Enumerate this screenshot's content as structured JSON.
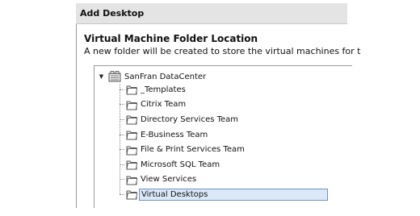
{
  "dialog": {
    "title": "Add Desktop"
  },
  "section": {
    "heading": "Virtual Machine Folder Location",
    "description": "A new folder will be created to store the virtual machines for t"
  },
  "tree": {
    "root": {
      "label": "SanFran DataCenter",
      "icon": "datacenter-icon",
      "expanded": true
    },
    "children": [
      {
        "label": "_Templates",
        "icon": "folder-icon",
        "selected": false
      },
      {
        "label": "Citrix Team",
        "icon": "folder-icon",
        "selected": false
      },
      {
        "label": "Directory Services Team",
        "icon": "folder-icon",
        "selected": false
      },
      {
        "label": "E-Business Team",
        "icon": "folder-icon",
        "selected": false
      },
      {
        "label": "File & Print Services Team",
        "icon": "folder-icon",
        "selected": false
      },
      {
        "label": "Microsoft SQL Team",
        "icon": "folder-icon",
        "selected": false
      },
      {
        "label": "View Services",
        "icon": "folder-icon",
        "selected": false
      },
      {
        "label": "Virtual Desktops",
        "icon": "folder-icon",
        "selected": true
      }
    ]
  },
  "colors": {
    "titlebar": "#e4e4e4",
    "selection_fill": "#dbe8f8",
    "selection_border": "#6f93c6"
  }
}
